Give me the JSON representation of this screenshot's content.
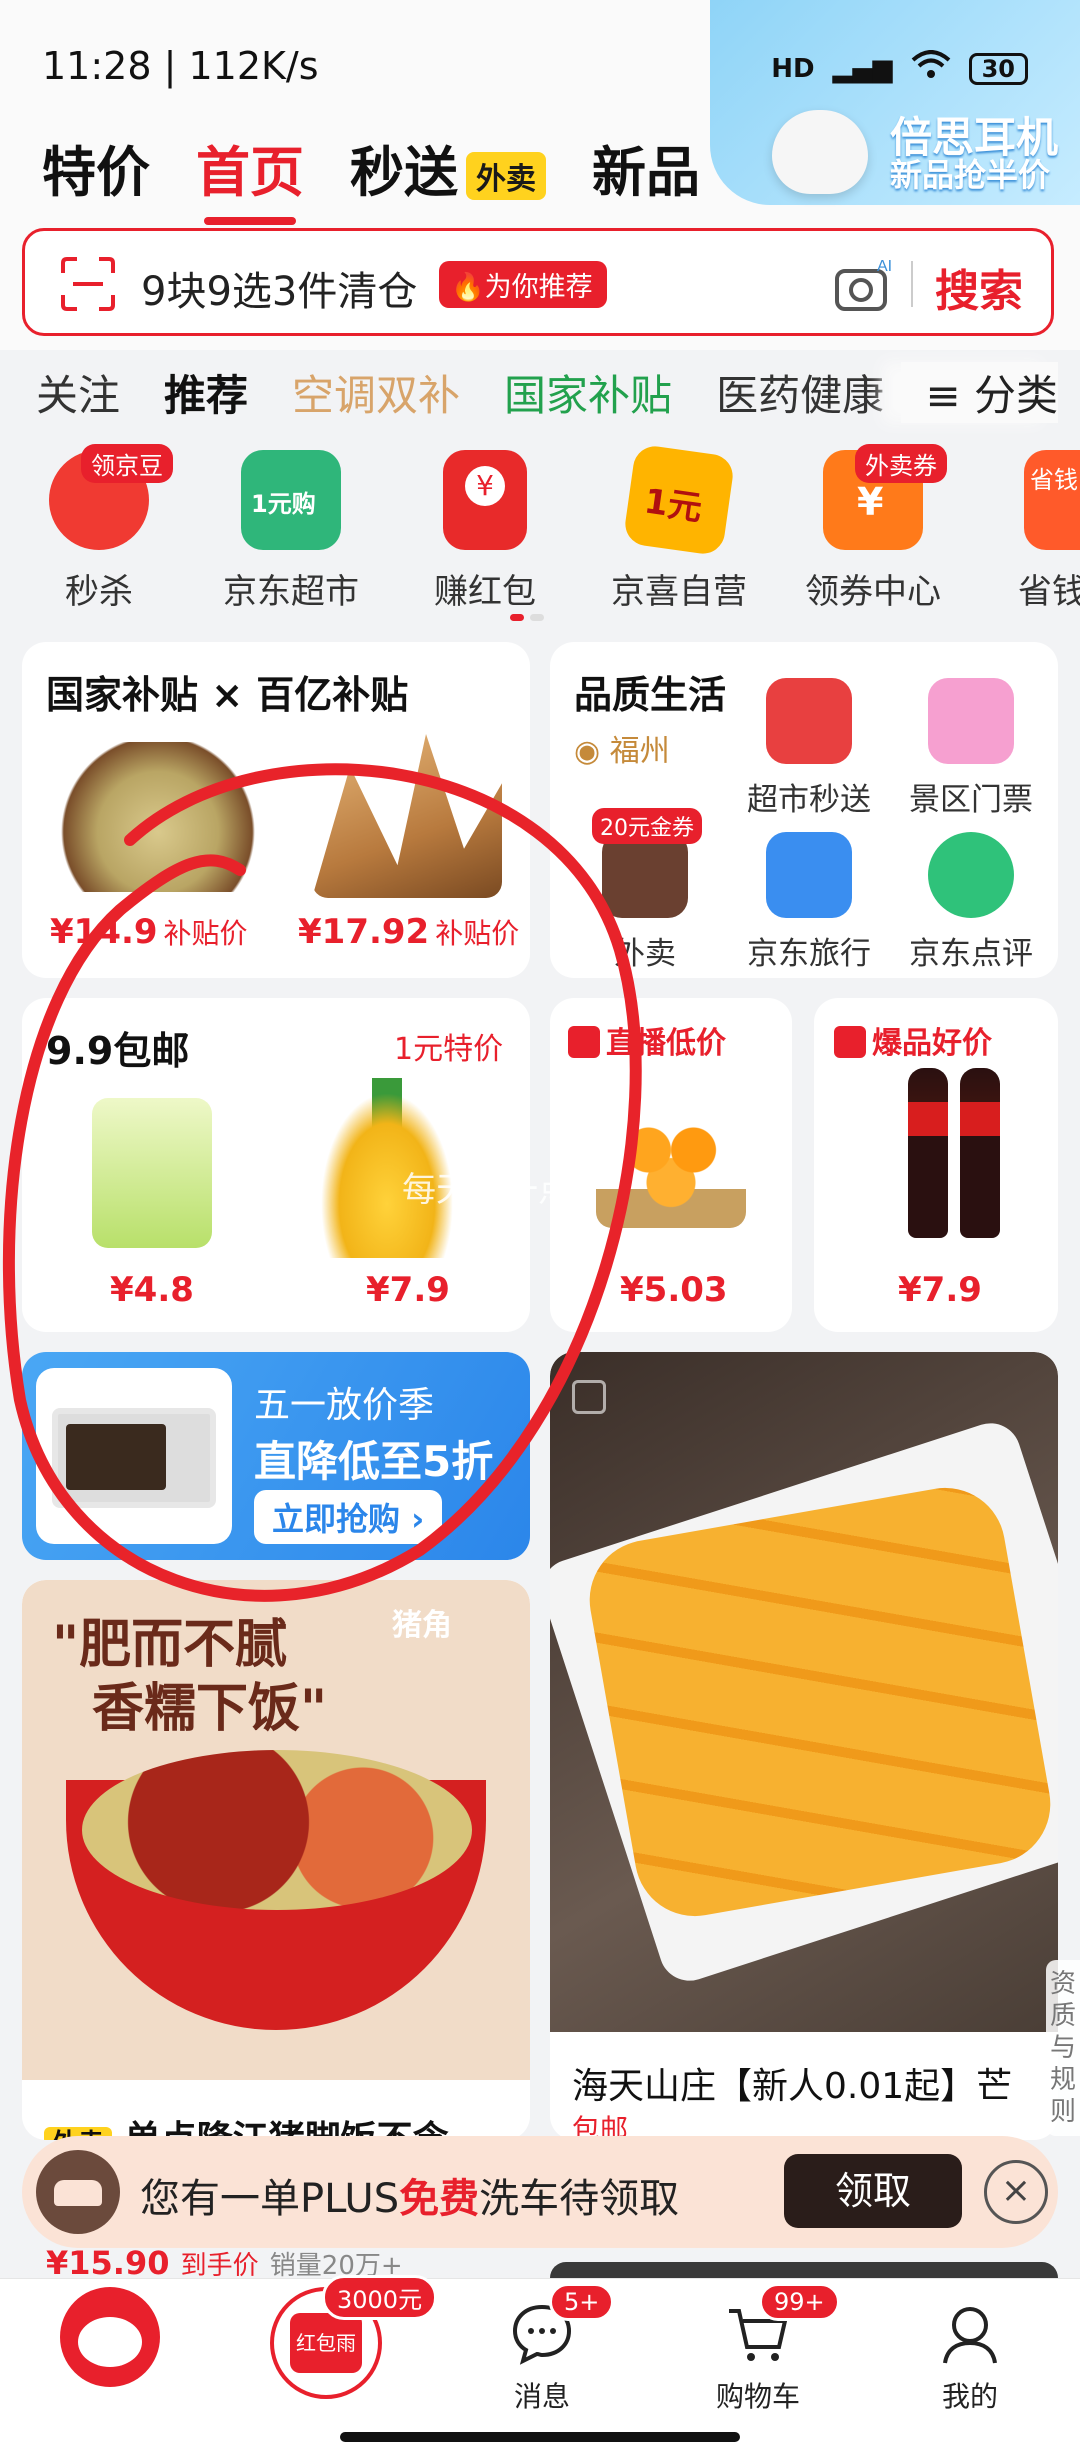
{
  "status_bar": {
    "time_speed": "11:28 | 112K/s",
    "battery": "30",
    "network": "HD"
  },
  "header_ad": {
    "title": "倍思耳机",
    "subtitle": "新品抢半价"
  },
  "main_tabs": [
    {
      "label": "特价"
    },
    {
      "label": "首页"
    },
    {
      "label": "秒送",
      "badge": "外卖"
    },
    {
      "label": "新品"
    }
  ],
  "search": {
    "text": "9块9选3件清仓",
    "recommend_tag": "为你推荐",
    "button": "搜索",
    "camera_badge": "AI"
  },
  "categories": [
    "关注",
    "推荐",
    "空调双补",
    "国家补贴",
    "医药健康",
    "分类"
  ],
  "quick_icons": [
    {
      "label": "秒杀",
      "badge": "领京豆"
    },
    {
      "label": "京东超市",
      "badge": "1元购"
    },
    {
      "label": "赚红包",
      "badge": ""
    },
    {
      "label": "京喜自营",
      "badge": "1元"
    },
    {
      "label": "领券中心",
      "badge": "外卖券"
    },
    {
      "label": "省钱",
      "badge": "省钱"
    }
  ],
  "subsidy_card": {
    "title": "国家补贴 × 百亿补贴",
    "items": [
      {
        "price": "¥14.9",
        "tag": "补贴价"
      },
      {
        "price": "¥17.92",
        "tag": "补贴价"
      }
    ]
  },
  "quality_life": {
    "title": "品质生活",
    "location": "福州",
    "services": [
      {
        "label": "超市秒送"
      },
      {
        "label": "景区门票"
      },
      {
        "label": "外卖",
        "badge": "20元金券"
      },
      {
        "label": "京东旅行"
      },
      {
        "label": "京东点评"
      }
    ]
  },
  "free_ship_card": {
    "title": "9.9包邮",
    "tag": "1元特价",
    "items": [
      {
        "price": "¥4.8"
      },
      {
        "price": "¥7.9"
      }
    ]
  },
  "live_card": {
    "tag": "直播低价",
    "price": "¥5.03"
  },
  "hot_card": {
    "tag": "爆品好价",
    "price": "¥7.9"
  },
  "promo_banner": {
    "line1": "五一放价季",
    "line2": "直降低至5折",
    "button": "立即抢购 ›"
  },
  "feed_left": {
    "img_brand": "猪角",
    "img_slogan_1": "\"肥而不腻",
    "img_slogan_2": "香糯下饭\"",
    "badge": "外卖",
    "title": "单点隆江猪脚饭不含",
    "price": "¥15.90",
    "price_tag": "到手价",
    "sales": "销量20万+"
  },
  "feed_right": {
    "title": "海天山庄【新人0.01起】芒",
    "sub": "包邮"
  },
  "plus_bar": {
    "text_pre": "您有一单PLUS",
    "text_em": "免费",
    "text_post": "洗车待领取",
    "button": "领取",
    "close": "×"
  },
  "side_rule": "资质与规则",
  "watermark": "每天省一点",
  "bottom_nav": [
    {
      "label": "",
      "name": "home"
    },
    {
      "label": "",
      "name": "red-packet",
      "bubble": "3000元",
      "inner": "红包雨"
    },
    {
      "label": "消息",
      "name": "messages",
      "bubble": "5+"
    },
    {
      "label": "购物车",
      "name": "cart",
      "bubble": "99+"
    },
    {
      "label": "我的",
      "name": "profile"
    }
  ],
  "colors": {
    "brand_red": "#e8202c",
    "accent_yellow": "#ffd21e",
    "gold": "#d8a46a",
    "green": "#22a14d"
  }
}
